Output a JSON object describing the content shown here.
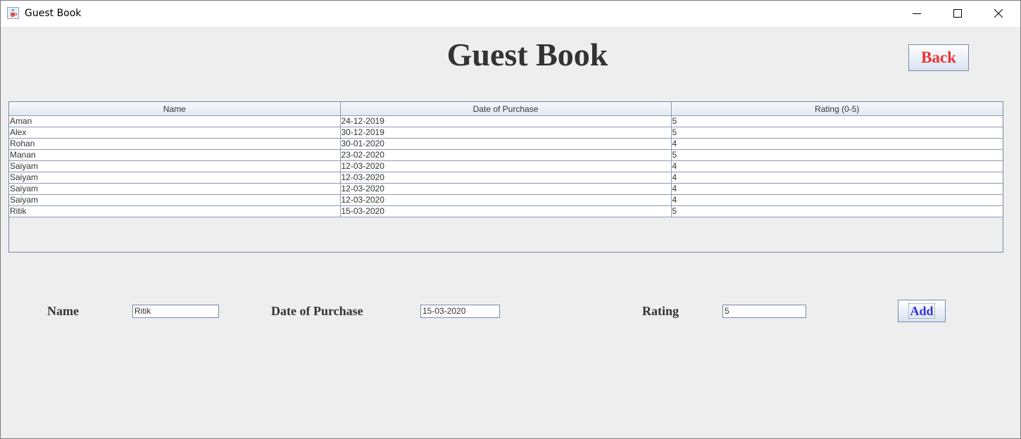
{
  "window": {
    "title": "Guest Book",
    "icon": "java-cup-icon",
    "controls": [
      "minimize-icon",
      "maximize-icon",
      "close-icon"
    ]
  },
  "header": {
    "title": "Guest Book",
    "back_label": "Back"
  },
  "table": {
    "columns": [
      "Name",
      "Date of Purchase",
      "Rating (0-5)"
    ],
    "rows": [
      [
        "Aman",
        "24-12-2019",
        "5"
      ],
      [
        "Alex",
        "30-12-2019",
        "5"
      ],
      [
        "Rohan",
        "30-01-2020",
        "4"
      ],
      [
        "Manan",
        "23-02-2020",
        "5"
      ],
      [
        "Saiyam",
        "12-03-2020",
        "4"
      ],
      [
        "Saiyam",
        "12-03-2020",
        "4"
      ],
      [
        "Saiyam",
        "12-03-2020",
        "4"
      ],
      [
        "Saiyam",
        "12-03-2020",
        "4"
      ],
      [
        "Ritik",
        "15-03-2020",
        "5"
      ]
    ]
  },
  "form": {
    "name_label": "Name",
    "name_value": "Ritik",
    "date_label": "Date of Purchase",
    "date_value": "15-03-2020",
    "rating_label": "Rating",
    "rating_value": "5",
    "add_label": "Add"
  },
  "colors": {
    "back_text": "#ee3333",
    "add_text": "#3333dd",
    "heading_text": "#333333"
  }
}
